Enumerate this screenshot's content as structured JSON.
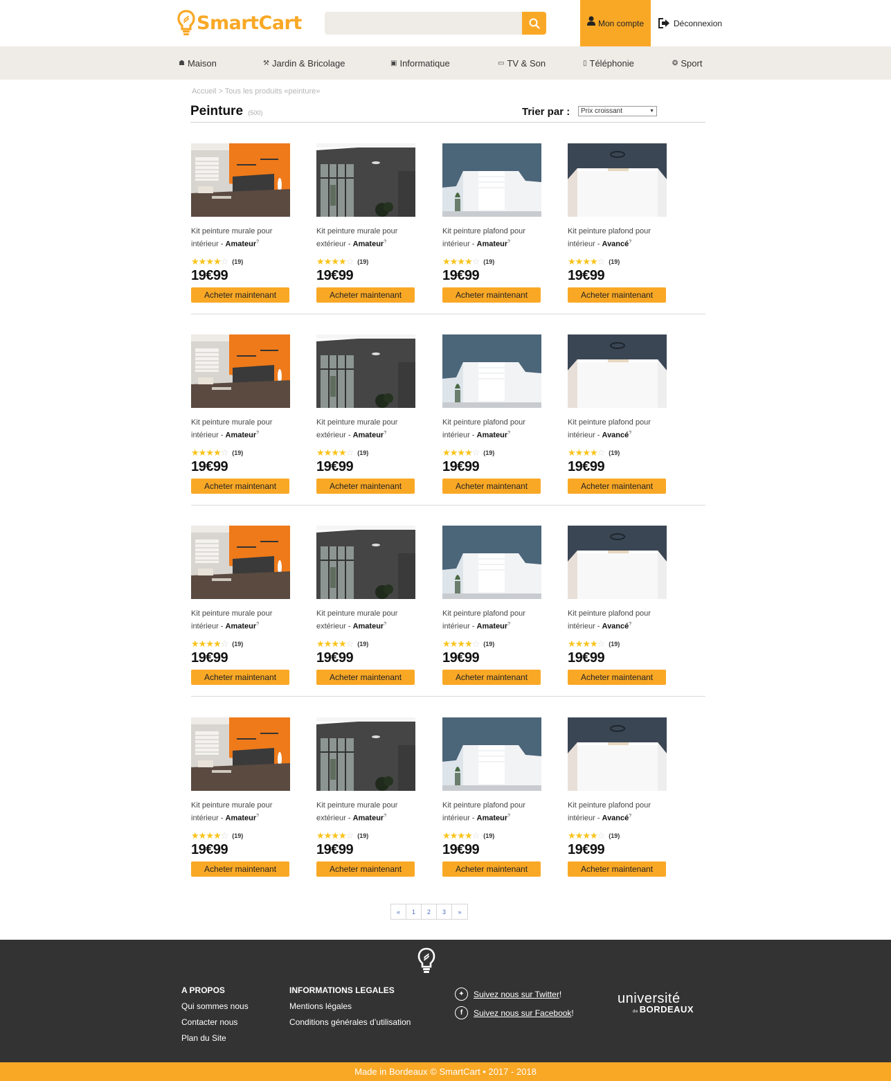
{
  "brand": {
    "name": "SmartCart",
    "accent": "#f9a826",
    "dark": "#333333"
  },
  "header": {
    "search_placeholder": "",
    "account_label": "Mon compte",
    "logout_label": "Déconnexion"
  },
  "nav": {
    "items": [
      {
        "label": "Maison",
        "icon": "home-icon"
      },
      {
        "label": "Jardin & Bricolage",
        "icon": "wrench-icon"
      },
      {
        "label": "Informatique",
        "icon": "laptop-icon"
      },
      {
        "label": "TV & Son",
        "icon": "tv-icon"
      },
      {
        "label": "Téléphonie",
        "icon": "phone-icon"
      },
      {
        "label": "Sport",
        "icon": "ball-icon"
      }
    ]
  },
  "breadcrumb": "Accueil > Tous les produits «peinture»",
  "listing": {
    "title": "Peinture",
    "count": "(500)",
    "sort_label": "Trier par :",
    "sort_value": "Prix croissant"
  },
  "products": [
    {
      "line1": "Kit peinture murale pour",
      "line2": "intérieur - ",
      "level": "Amateur",
      "rating": 4,
      "reviews": "(19)",
      "price": "19€99",
      "cta": "Acheter maintenant",
      "image": "orange-living-room"
    },
    {
      "line1": "Kit peinture murale pour",
      "line2": "extérieur - ",
      "level": "Amateur",
      "rating": 4,
      "reviews": "(19)",
      "price": "19€99",
      "cta": "Acheter maintenant",
      "image": "grey-house-exterior"
    },
    {
      "line1": "Kit peinture plafond pour",
      "line2": "intérieur - ",
      "level": "Amateur",
      "rating": 4,
      "reviews": "(19)",
      "price": "19€99",
      "cta": "Acheter maintenant",
      "image": "blue-ceiling-room"
    },
    {
      "line1": "Kit peinture plafond pour",
      "line2": "intérieur - ",
      "level": "Avancé",
      "rating": 4,
      "reviews": "(19)",
      "price": "19€99",
      "cta": "Acheter maintenant",
      "image": "dark-ceiling-room"
    }
  ],
  "pagination": [
    "«",
    "1",
    "2",
    "3",
    "»"
  ],
  "footer": {
    "about_title": "A PROPOS",
    "about_links": [
      "Qui sommes nous",
      "Contacter nous",
      "Plan du Site"
    ],
    "legal_title": "INFORMATIONS LEGALES",
    "legal_links": [
      "Mentions légales",
      "Conditions générales d’utilisation"
    ],
    "twitter": "Suivez nous sur Twitter",
    "facebook": "Suivez nous sur Facebook",
    "exclaim": " !",
    "univ_line1": "université",
    "univ_de": "de",
    "univ_line2": "BORDEAUX",
    "copyright": "Made in Bordeaux © SmartCart  •  2017 - 2018"
  }
}
